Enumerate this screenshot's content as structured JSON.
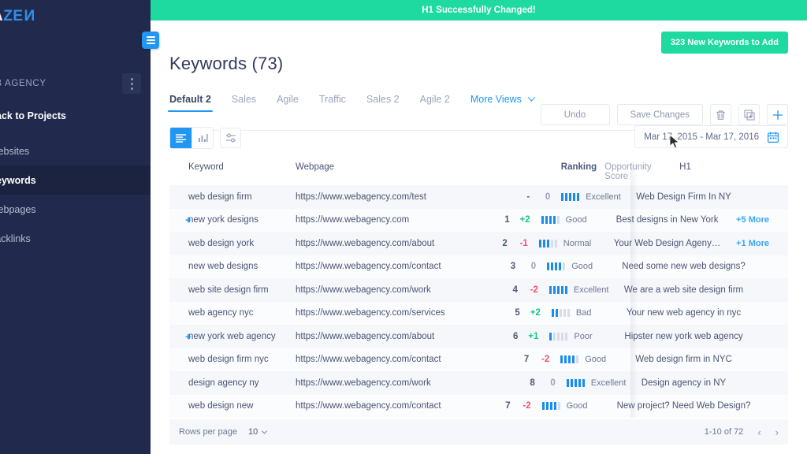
{
  "sidebar": {
    "logo": {
      "part1": "A",
      "part2": "ZE",
      "part3": "N"
    },
    "project_name": "EB AGENCY",
    "menu_icon": "kebab-menu-icon",
    "items": [
      {
        "label": "Back to Projects",
        "style": "bold"
      },
      {
        "label": "Websites",
        "style": "normal"
      },
      {
        "label": "Keywords",
        "style": "active"
      },
      {
        "label": "Webpages",
        "style": "normal"
      },
      {
        "label": "Backlinks",
        "style": "normal"
      }
    ]
  },
  "toast": {
    "message": "H1 Successfully Changed!",
    "color": "#1ed9a0"
  },
  "header": {
    "title": "Keywords (73)",
    "new_keywords_button": "323 New Keywords to Add"
  },
  "tabs": [
    {
      "label": "Default 2",
      "active": true
    },
    {
      "label": "Sales",
      "active": false
    },
    {
      "label": "Agile",
      "active": false
    },
    {
      "label": "Traffic",
      "active": false
    },
    {
      "label": "Sales 2",
      "active": false
    },
    {
      "label": "Agile 2",
      "active": false
    }
  ],
  "more_views": {
    "label": "More Views"
  },
  "toolbar": {
    "undo_label": "Undo",
    "save_label": "Save Changes",
    "delete_icon": "trash-icon",
    "duplicate_icon": "copy-icon",
    "add_icon": "plus-icon"
  },
  "view_controls": {
    "list_icon": "list-view-icon",
    "chart_icon": "bar-chart-icon",
    "filter_icon": "sliders-filter-icon",
    "active": "list"
  },
  "date_range": {
    "value": "Mar 17, 2015 - Mar 17, 2016",
    "icon": "calendar-icon"
  },
  "table": {
    "columns": [
      "Keyword",
      "Webpage",
      "Ranking",
      "Opportunity Score",
      "H1"
    ],
    "rows": [
      {
        "expand": "",
        "keyword": "web design firm",
        "webpage": "https://www.webagency.com/test",
        "rank": "-",
        "delta": "0",
        "delta_dir": "zero",
        "score": 5,
        "score_label": "Excellent",
        "h1": "Web Design Firm In NY",
        "more": ""
      },
      {
        "expand": "+",
        "keyword": "new york designs",
        "webpage": "https://www.webagency.com",
        "rank": "1",
        "delta": "+2",
        "delta_dir": "up",
        "score": 4,
        "score_label": "Good",
        "h1": "Best designs in New York",
        "more": "+5 More"
      },
      {
        "expand": "",
        "keyword": "web design york",
        "webpage": "https://www.webagency.com/about",
        "rank": "2",
        "delta": "-1",
        "delta_dir": "down",
        "score": 3,
        "score_label": "Normal",
        "h1": "Your Web Design Ageny…",
        "more": "+1 More"
      },
      {
        "expand": "",
        "keyword": "new web designs",
        "webpage": "https://www.webagency.com/contact",
        "rank": "3",
        "delta": "0",
        "delta_dir": "zero",
        "score": 4,
        "score_label": "Good",
        "h1": "Need some new web designs?",
        "more": ""
      },
      {
        "expand": "",
        "keyword": "web site design firm",
        "webpage": "https://www.webagency.com/work",
        "rank": "4",
        "delta": "-2",
        "delta_dir": "down",
        "score": 5,
        "score_label": "Excellent",
        "h1": "We are a web site design firm",
        "more": ""
      },
      {
        "expand": "",
        "keyword": "web agency nyc",
        "webpage": "https://www.webagency.com/services",
        "rank": "5",
        "delta": "+2",
        "delta_dir": "up",
        "score": 2,
        "score_label": "Bad",
        "h1": "Your new web agency in nyc",
        "more": ""
      },
      {
        "expand": "+",
        "keyword": "new york web agency",
        "webpage": "https://www.webagency.com/about",
        "rank": "6",
        "delta": "+1",
        "delta_dir": "up",
        "score": 1,
        "score_label": "Poor",
        "h1": "Hipster new york web agency",
        "more": ""
      },
      {
        "expand": "",
        "keyword": "web design firm nyc",
        "webpage": "https://www.webagency.com/contact",
        "rank": "7",
        "delta": "-2",
        "delta_dir": "down",
        "score": 4,
        "score_label": "Good",
        "h1": "Web design firm in NYC",
        "more": ""
      },
      {
        "expand": "",
        "keyword": "design agency ny",
        "webpage": "https://www.webagency.com/work",
        "rank": "8",
        "delta": "0",
        "delta_dir": "zero",
        "score": 5,
        "score_label": "Excellent",
        "h1": "Design agency in NY",
        "more": ""
      },
      {
        "expand": "",
        "keyword": "web design new",
        "webpage": "https://www.webagency.com/contact",
        "rank": "7",
        "delta": "-2",
        "delta_dir": "down",
        "score": 4,
        "score_label": "Good",
        "h1": "New project? Need Web Design?",
        "more": ""
      }
    ]
  },
  "footer": {
    "rows_per_page_label": "Rows per page",
    "rows_per_page_value": "10",
    "range_label": "1-10 of 72",
    "prev_icon": "chevron-left-icon",
    "next_icon": "chevron-right-icon"
  },
  "colors": {
    "accent_blue": "#2196f3",
    "accent_green": "#1ed9a0",
    "sidebar_bg": "#212a4d",
    "positive": "#1bc47d",
    "negative": "#f0506e"
  }
}
